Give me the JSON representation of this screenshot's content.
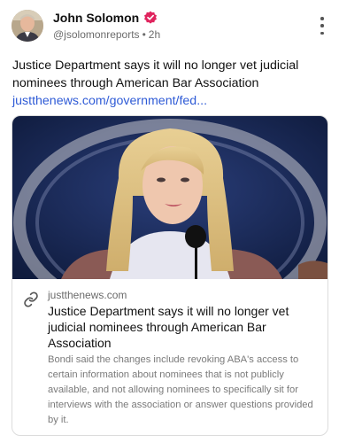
{
  "post": {
    "author_name": "John Solomon",
    "handle": "@jsolomonreports",
    "separator": "•",
    "time": "2h",
    "text": "Justice Department says it will no longer vet judicial nominees through American Bar Association",
    "link_text": "justthenews.com/government/fed...",
    "verified_color": "#e0245e"
  },
  "card": {
    "domain": "justthenews.com",
    "title": "Justice Department says it will no longer vet judicial nominees through American Bar Association",
    "description": "Bondi said the changes include revoking ABA's access to certain information about nominees that is not publicly available, and not allowing nominees to specifically sit for interviews with the association or answer questions provided by it."
  },
  "icons": {
    "avatar": "avatar-photo",
    "verified": "verified-badge-icon",
    "more": "more-vertical-icon",
    "link": "link-icon"
  },
  "colors": {
    "link": "#2f5bd6",
    "secondary_text": "#6b6b6b"
  }
}
